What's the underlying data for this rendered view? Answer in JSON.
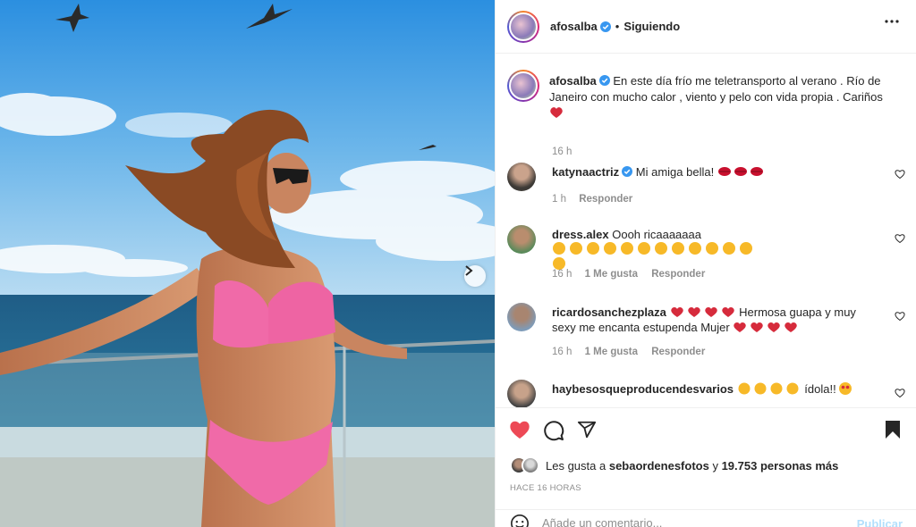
{
  "post": {
    "username": "afosalba",
    "follow_status": "Siguiendo",
    "separator": "•",
    "caption": "En este día frío me teletransporto al verano . Río de Janeiro con mucho calor , viento y pelo con vida propia . Cariños",
    "caption_time": "16 h"
  },
  "comments": [
    {
      "username": "katynaactriz",
      "verified": true,
      "text": "Mi amiga bella!",
      "emoji_count": 3,
      "emoji": "kiss-lips",
      "time": "1 h",
      "likes_label": "",
      "reply_label": "Responder"
    },
    {
      "username": "dress.alex",
      "verified": false,
      "text": "Oooh ricaaaaaaa",
      "emoji_count": 13,
      "emoji": "kissing-face",
      "time": "16 h",
      "likes_label": "1 Me gusta",
      "reply_label": "Responder"
    },
    {
      "username": "ricardosanchezplaza",
      "verified": false,
      "pre_emoji_count": 4,
      "text": "Hermosa guapa y muy sexy me encanta estupenda Mujer",
      "emoji_count": 4,
      "emoji": "red-heart",
      "time": "16 h",
      "likes_label": "1 Me gusta",
      "reply_label": "Responder"
    },
    {
      "username": "haybesosqueproducendesvarios",
      "verified": false,
      "text": "ídola!!",
      "emoji": "clapping-hands"
    }
  ],
  "actions": {
    "likes_prefix": "Les gusta a",
    "likes_user": "sebaordenesfotos",
    "likes_middle": "y",
    "likes_count": "19.753 personas más",
    "time_ago": "HACE 16 HORAS"
  },
  "composer": {
    "placeholder": "Añade un comentario...",
    "publish_label": "Publicar"
  },
  "icons": {
    "like": "heart-icon-filled-red",
    "comment": "comment-icon",
    "share": "send-icon",
    "save": "bookmark-icon-filled",
    "next": "chevron-right-icon",
    "more": "more-options-icon",
    "emoji": "emoji-icon",
    "verified": "verified-badge-icon"
  },
  "colors": {
    "like_red": "#ed4956",
    "verified_blue": "#3897f0",
    "muted": "#8e8e8e",
    "publish_disabled": "#b2dffc"
  }
}
